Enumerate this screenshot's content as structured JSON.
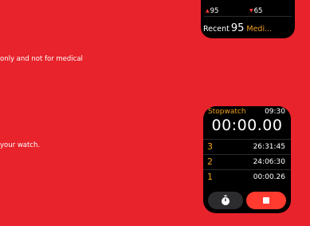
{
  "left_text": {
    "line1": "only and not for medical",
    "line2": "your watch."
  },
  "heart_rate": {
    "high_value": "95",
    "low_value": "65",
    "high_icon": "arrow-up-icon",
    "low_icon": "arrow-down-icon",
    "recent_label": "Recent",
    "recent_value": "95",
    "recent_extra": "Medi..."
  },
  "stopwatch": {
    "title": "Stopwatch",
    "clock": "09:30",
    "elapsed": "00:00.00",
    "laps": [
      {
        "number": "3",
        "time": "26:31:45"
      },
      {
        "number": "2",
        "time": "24:06:30"
      },
      {
        "number": "1",
        "time": "00:00.26"
      }
    ],
    "lap_button_icon": "stopwatch-icon",
    "stop_button_icon": "stop-icon"
  },
  "colors": {
    "background": "#e8232c",
    "accent_orange": "#f0a020",
    "stop_red": "#ff3b30",
    "watch_black": "#000000"
  }
}
